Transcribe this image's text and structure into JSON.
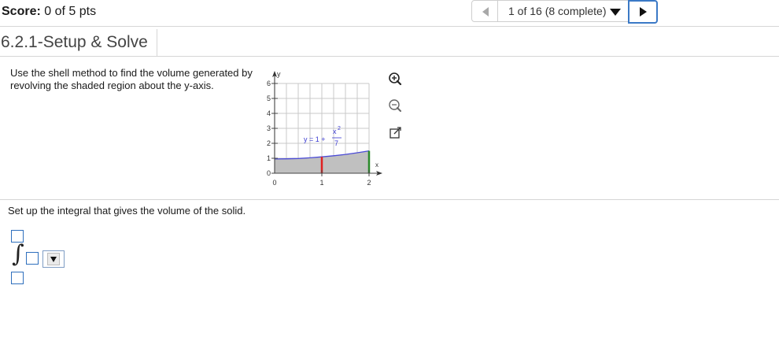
{
  "score": {
    "label": "Score:",
    "value": "0 of 5 pts"
  },
  "nav": {
    "position": "1 of 16 (8 complete)"
  },
  "title": "6.2.1-Setup & Solve",
  "prompt": "Use the shell method to find the volume generated by revolving the shaded region about the y-axis.",
  "graph": {
    "y_label": "y",
    "x_label": "x",
    "y_ticks": [
      "6",
      "5",
      "4",
      "3",
      "2",
      "1",
      "0"
    ],
    "x_ticks": [
      "0",
      "1",
      "2"
    ],
    "curve_label_prefix": "y = 1 +",
    "curve_label_numerator": "x",
    "curve_label_exponent": "2",
    "curve_label_denominator": "7",
    "colors": {
      "curve": "#4b4bd6",
      "shell_line": "#e02020",
      "boundary": "#2a8a2a",
      "shade": "#c0c0c0",
      "label": "#3a3ad0"
    }
  },
  "tools": [
    "zoom-in-icon",
    "zoom-out-icon",
    "popout-icon"
  ],
  "question": "Set up the integral that gives the volume of the solid.",
  "accent": "#3b79c6"
}
